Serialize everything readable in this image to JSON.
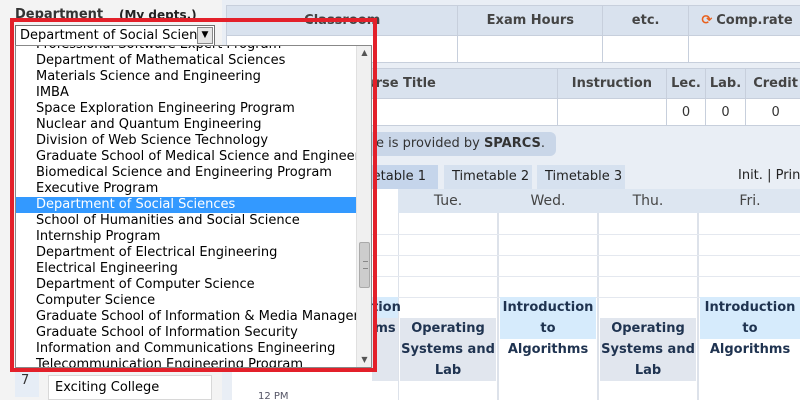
{
  "department": {
    "label": "Department",
    "my_depts": "(My depts.)",
    "selected_value": "Department of Social Science",
    "options": [
      "Professional Software Expert Program",
      "Department of Mathematical Sciences",
      "Materials Science and Engineering",
      "IMBA",
      "Space Exploration Engineering Program",
      "Nuclear and Quantum Engineering",
      "Division of Web Science Technology",
      "Graduate School of Medical Science and Engineering",
      "Biomedical Science and Engineering Program",
      "Executive Program",
      "Department of Social Sciences",
      "School of Humanities and Social Science",
      "Internship Program",
      "Department of Electrical Engineering",
      "Electrical Engineering",
      "Department of Computer Science",
      "Computer Science",
      "Graduate School of Information & Media Management",
      "Graduate School of Information Security",
      "Information and Communications Engineering",
      "Telecommunication Engineering Program"
    ],
    "highlighted_option": "Department of Social Sciences"
  },
  "left_bottom": {
    "row_number": "7",
    "item": "Exciting College"
  },
  "top_table": {
    "headers": [
      "Classroom",
      "Exam Hours",
      "etc.",
      "Comp.rate"
    ],
    "comp_icon": "refresh-icon"
  },
  "course_table": {
    "headers": [
      "Course Title",
      "Instruction",
      "Lec.",
      "Lab.",
      "Credit"
    ],
    "values": [
      "",
      "",
      "0",
      "0",
      "0"
    ]
  },
  "notice": {
    "prefix": "e is provided by ",
    "brand": "SPARCS",
    "suffix": "."
  },
  "tabs": [
    "metable 1",
    "Timetable 2",
    "Timetable 3"
  ],
  "timetable_actions": {
    "init": "Init.",
    "separator": "|",
    "print": "Prin"
  },
  "days": [
    "Tue.",
    "Wed.",
    "Thu.",
    "Fri."
  ],
  "classes": {
    "intro_algorithms": "Introduction to Algorithms",
    "intro_partial_top": "tion",
    "intro_partial_bottom": "ms",
    "operating_systems": "Operating Systems and Lab"
  },
  "time_label": "12 PM",
  "colors": {
    "highlight_border": "#e3202a",
    "selected_option": "#3399ff",
    "accent": "#e8601c"
  }
}
